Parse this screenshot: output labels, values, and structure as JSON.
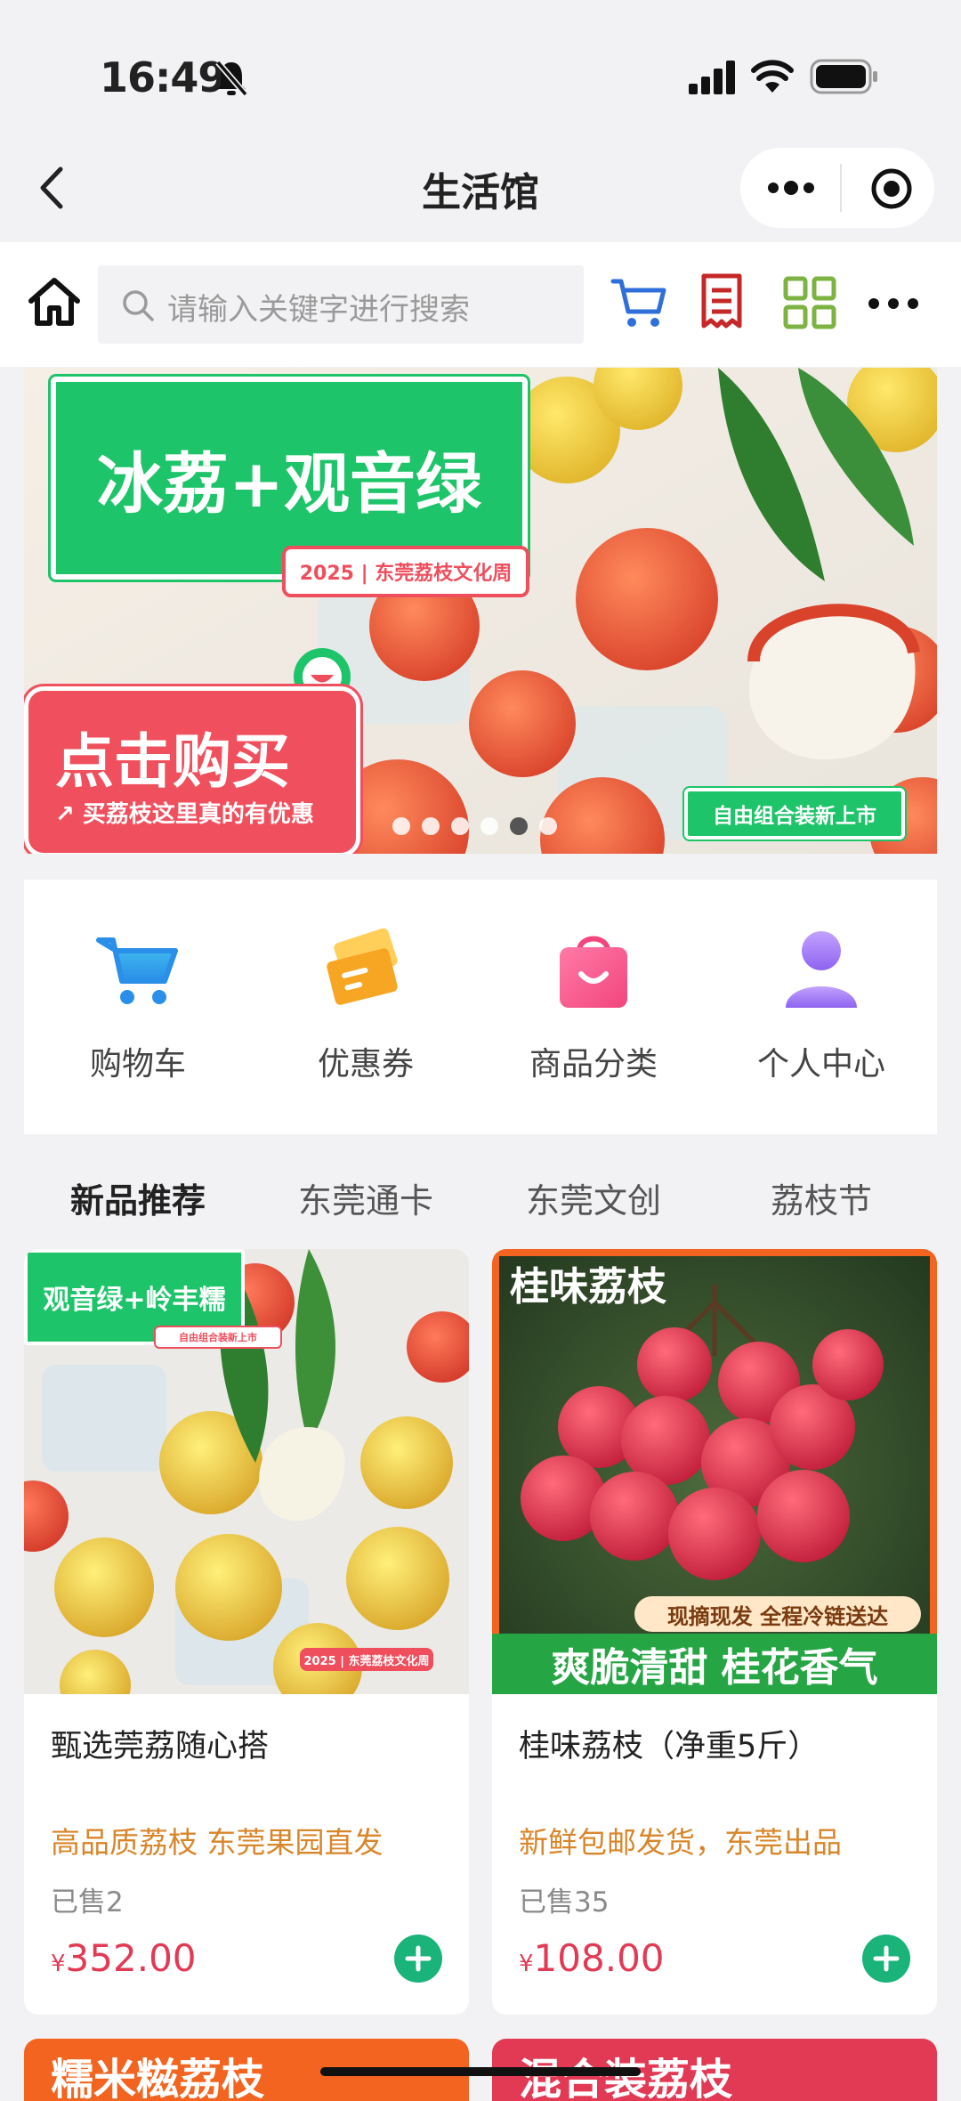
{
  "status_bar": {
    "time": "16:49"
  },
  "nav": {
    "title": "生活馆"
  },
  "search": {
    "placeholder": "请输入关键字进行搜索"
  },
  "banner": {
    "title": "冰荔+观音绿",
    "tag": "2025 | 东莞荔枝文化周",
    "buy_label": "点击购买",
    "buy_sub": "↗ 买荔枝这里真的有优惠",
    "new_badge": "自由组合装新上市",
    "dots_count": 6,
    "active_dot": 5
  },
  "menu": [
    {
      "label": "购物车",
      "icon": "shopping-cart-icon"
    },
    {
      "label": "优惠券",
      "icon": "coupon-icon"
    },
    {
      "label": "商品分类",
      "icon": "shopping-bag-icon"
    },
    {
      "label": "个人中心",
      "icon": "user-icon"
    }
  ],
  "tabs": [
    {
      "label": "新品推荐",
      "active": true
    },
    {
      "label": "东莞通卡",
      "active": false
    },
    {
      "label": "东莞文创",
      "active": false
    },
    {
      "label": "荔枝节",
      "active": false
    }
  ],
  "products": [
    {
      "img_title": "观音绿+岭丰糯",
      "img_tag": "自由组合装新上市",
      "img_tag2": "2025 | 东莞荔枝文化周",
      "name": "甄选莞荔随心搭",
      "desc": "高品质荔枝 东莞果园直发",
      "sold": "已售2",
      "currency": "¥",
      "price": "352.00"
    },
    {
      "img_title": "桂味荔枝",
      "img_tag": "现摘现发 全程冷链送达",
      "img_tag2": "爽脆清甜 桂花香气",
      "name": "桂味荔枝（净重5斤）",
      "desc": "新鲜包邮发货，东莞出品",
      "sold": "已售35",
      "currency": "¥",
      "price": "108.00"
    }
  ],
  "more_products": [
    {
      "img_title": "糯米糍荔枝"
    },
    {
      "img_title": "混合装荔枝"
    }
  ],
  "colors": {
    "accent_green": "#1ec46a",
    "price_red": "#e23a55",
    "desc_orange": "#d9862a",
    "add_button": "#1ab37a"
  }
}
